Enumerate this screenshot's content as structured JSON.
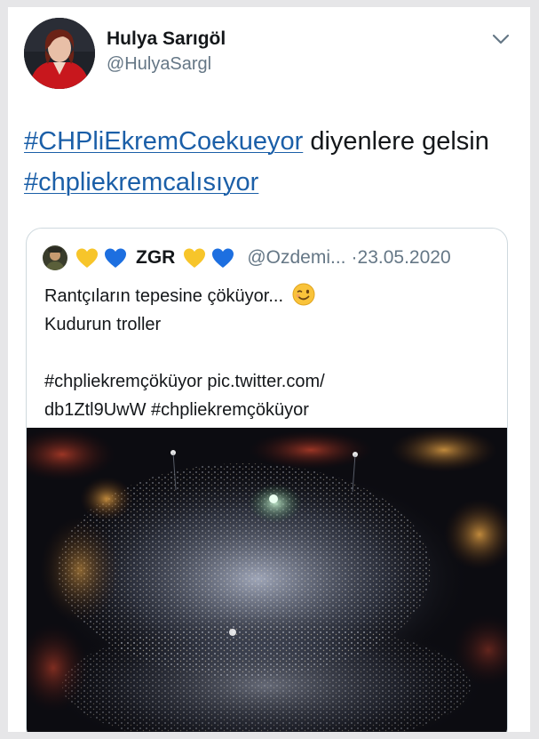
{
  "tweet": {
    "author": {
      "display_name": "Hulya Sarıgöl",
      "handle": "@HulyaSargl"
    },
    "text": {
      "hashtag_1": "#CHPliEkremCoekueyor",
      "text_1": " diyenlere gelsin ",
      "hashtag_2": "#chpliekremcalısıyor"
    },
    "menu_icon": "chevron-down-icon",
    "link_color": "#1b5fa8"
  },
  "quoted_tweet": {
    "author": {
      "display_name": "ZGR",
      "handle": "@Ozdemi...",
      "name_emojis": [
        "yellow-heart",
        "blue-heart"
      ],
      "trailing_emojis": [
        "yellow-heart",
        "blue-heart"
      ]
    },
    "separator": "·",
    "date": "23.05.2020",
    "body": {
      "line_1": "Rantçıların tepesine çöküyor...",
      "line_1_emoji": "winking-face",
      "line_2": "Kudurun troller",
      "line_3": "#chpliekremçöküyor pic.twitter.com/",
      "line_4": "db1Ztl9UwW #chpliekremçöküyor"
    },
    "media": "aerial-night-crowd-photo"
  }
}
